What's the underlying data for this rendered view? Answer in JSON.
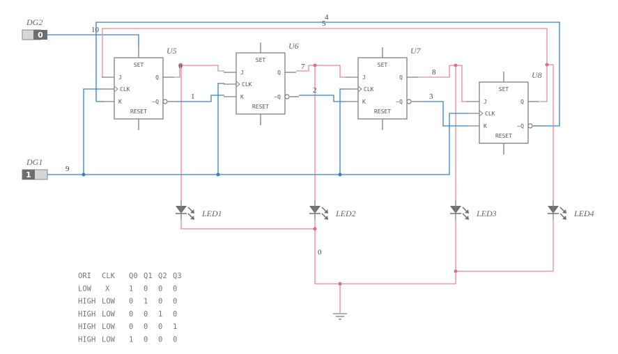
{
  "components": {
    "switch_dg2": {
      "ref": "DG2",
      "value": "0"
    },
    "switch_dg1": {
      "ref": "DG1",
      "value": "1"
    },
    "flipflops": [
      {
        "ref": "U5"
      },
      {
        "ref": "U6"
      },
      {
        "ref": "U7"
      },
      {
        "ref": "U8"
      }
    ],
    "pin_labels": {
      "set": "SET",
      "j": "J",
      "q": "Q",
      "clk": "CLK",
      "k": "K",
      "nq": "~Q",
      "reset": "RESET"
    },
    "leds": [
      {
        "ref": "LED1"
      },
      {
        "ref": "LED2"
      },
      {
        "ref": "LED3"
      },
      {
        "ref": "LED4"
      }
    ]
  },
  "nets": {
    "n0": "0",
    "n1": "1",
    "n2": "2",
    "n3": "3",
    "n4": "4",
    "n5": "5",
    "n6": "6",
    "n7": "7",
    "n8": "8",
    "n9": "9",
    "n10": "10"
  },
  "wire_colors": {
    "blue": "#3b7fbf",
    "red": "#e38c9a"
  },
  "truth_table": {
    "headers": [
      "ORI",
      "CLK",
      "Q0",
      "Q1",
      "Q2",
      "Q3"
    ],
    "rows": [
      [
        "LOW",
        "X",
        "1",
        "0",
        "0",
        "0"
      ],
      [
        "HIGH",
        "LOW",
        "0",
        "1",
        "0",
        "0"
      ],
      [
        "HIGH",
        "LOW",
        "0",
        "0",
        "1",
        "0"
      ],
      [
        "HIGH",
        "LOW",
        "0",
        "0",
        "0",
        "1"
      ],
      [
        "HIGH",
        "LOW",
        "1",
        "0",
        "0",
        "0"
      ]
    ]
  }
}
